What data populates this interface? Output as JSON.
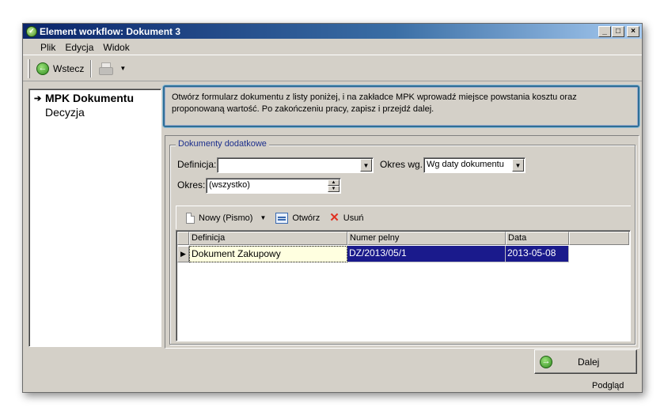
{
  "window": {
    "title": "Element workflow: Dokument 3",
    "controls": {
      "minimize": "_",
      "maximize": "□",
      "close": "×"
    }
  },
  "menu": {
    "items": [
      {
        "label": "Plik"
      },
      {
        "label": "Edycja"
      },
      {
        "label": "Widok"
      }
    ]
  },
  "toolbar": {
    "back_label": "Wstecz",
    "back_icon": "green-left-arrow-icon",
    "print_icon": "printer-icon"
  },
  "nav": {
    "items": [
      {
        "label": "MPK Dokumentu",
        "active": true
      },
      {
        "label": "Decyzja",
        "active": false
      }
    ]
  },
  "info": {
    "text": "Otwórz formularz dokumentu z listy poniżej, i na zakładce MPK wprowadź miejsce powstania kosztu oraz proponowaną wartość. Po zakończeniu pracy, zapisz i przejdź dalej."
  },
  "documents": {
    "group_title": "Dokumenty dodatkowe",
    "filters": {
      "definition_label": "Definicja:",
      "definition_value": "",
      "period_by_label": "Okres wg.:",
      "period_by_value": "Wg daty dokumentu",
      "period_label": "Okres:",
      "period_value": "(wszystko)"
    },
    "actions": {
      "new_label": "Nowy (Pismo)",
      "open_label": "Otwórz",
      "delete_label": "Usuń"
    },
    "grid": {
      "columns": [
        "Definicja",
        "Numer pelny",
        "Data"
      ],
      "rows": [
        {
          "definicja": "Dokument Zakupowy",
          "numer": "DZ/2013/05/1",
          "data": "2013-05-08"
        }
      ]
    }
  },
  "footer": {
    "next_label": "Dalej",
    "preview_label": "Podgląd"
  },
  "colors": {
    "accent": "#2f6f96",
    "selection": "#1a1a8c",
    "titlebar": "#0a246a",
    "legend_text": "#1c2f8c"
  }
}
